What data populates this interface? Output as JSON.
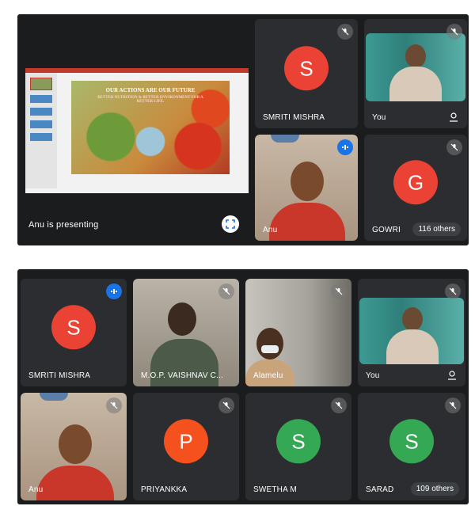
{
  "screen1": {
    "presentation": {
      "slide_title": "OUR ACTIONS ARE OUR FUTURE",
      "slide_subtitle": "BETTER NUTRITION & BETTER ENVIRONMENT FOR A BETTER LIFE.",
      "status_label": "Anu is presenting"
    },
    "tiles": [
      {
        "name": "SMRITI MISHRA",
        "initial": "S",
        "color": "#ea4335",
        "muted": true
      },
      {
        "name": "You",
        "muted": true,
        "video": true
      },
      {
        "name": "Anu",
        "speaking": true,
        "video": true
      },
      {
        "name": "GOWRI",
        "initial": "G",
        "color": "#ea4335",
        "muted": true,
        "others": "116 others"
      }
    ]
  },
  "screen2": {
    "tiles": [
      {
        "name": "SMRITI MISHRA",
        "initial": "S",
        "color": "#ea4335",
        "speaking": true
      },
      {
        "name": "M.O.P. VAISHNAV C...",
        "video": true,
        "muted": true
      },
      {
        "name": "Alamelu",
        "video": true,
        "muted": true
      },
      {
        "name": "You",
        "video": true,
        "muted": true
      },
      {
        "name": "Anu",
        "video": true,
        "muted": true
      },
      {
        "name": "PRIYANKKA",
        "initial": "P",
        "color": "#f4511e",
        "muted": true
      },
      {
        "name": "SWETHA M",
        "initial": "S",
        "color": "#34a853",
        "muted": true
      },
      {
        "name": "SARAD",
        "initial": "S",
        "color": "#34a853",
        "muted": true,
        "others": "109 others"
      }
    ]
  },
  "colors": {
    "background": "#1b1c1e",
    "tile": "#2b2d30",
    "speaking": "#1a73e8"
  }
}
